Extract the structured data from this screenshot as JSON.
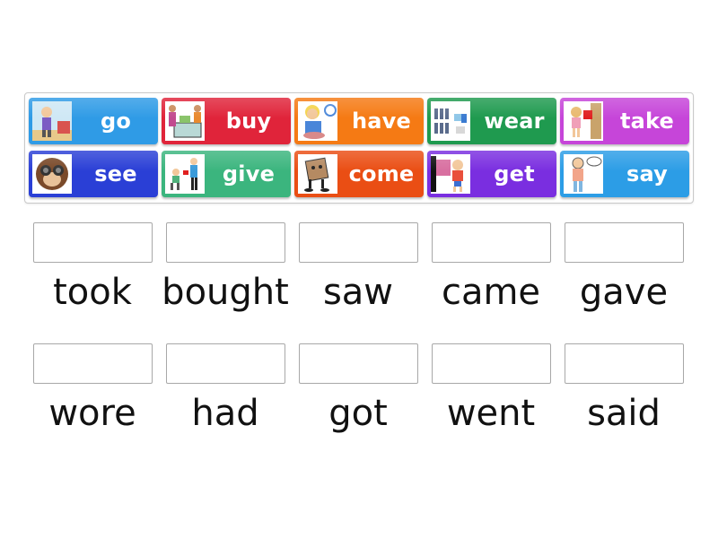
{
  "activity": {
    "type": "match-up",
    "tiles": [
      {
        "word": "go",
        "icon": "boy-walking-to-school-picture",
        "color": "#2f9be6"
      },
      {
        "word": "buy",
        "icon": "people-shopping-picture",
        "color": "#e0243a"
      },
      {
        "word": "have",
        "icon": "boy-eating-picture",
        "color": "#f57a14"
      },
      {
        "word": "wear",
        "icon": "clothes-picture",
        "color": "#1f9a4f"
      },
      {
        "word": "take",
        "icon": "girl-taking-book-picture",
        "color": "#c645d9"
      },
      {
        "word": "see",
        "icon": "monkey-binoculars-picture",
        "color": "#2a3fd6"
      },
      {
        "word": "give",
        "icon": "man-giving-gift-picture",
        "color": "#3bb57e"
      },
      {
        "word": "come",
        "icon": "cartoon-character-picture",
        "color": "#ea4e14"
      },
      {
        "word": "get",
        "icon": "boy-with-gift-picture",
        "color": "#7a2ee0"
      },
      {
        "word": "say",
        "icon": "boy-speaking-picture",
        "color": "#2c9de6"
      }
    ],
    "targets": [
      {
        "label": "took",
        "answer": ""
      },
      {
        "label": "bought",
        "answer": ""
      },
      {
        "label": "saw",
        "answer": ""
      },
      {
        "label": "came",
        "answer": ""
      },
      {
        "label": "gave",
        "answer": ""
      },
      {
        "label": "wore",
        "answer": ""
      },
      {
        "label": "had",
        "answer": ""
      },
      {
        "label": "got",
        "answer": ""
      },
      {
        "label": "went",
        "answer": ""
      },
      {
        "label": "said",
        "answer": ""
      }
    ]
  }
}
